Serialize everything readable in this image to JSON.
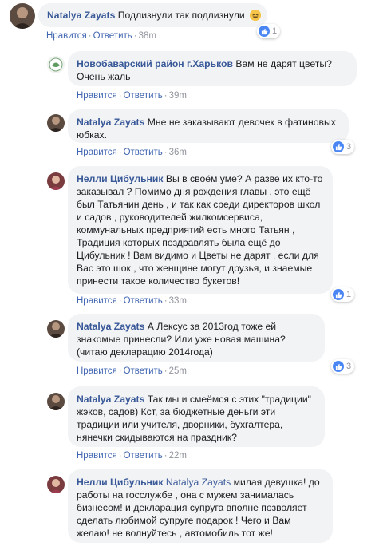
{
  "comments": [
    {
      "author": "Natalya Zayats",
      "text": "Подлизнули так подлизнули",
      "emoji": "laughing-emoji",
      "like_label": "Нравится",
      "reply_label": "Ответить",
      "time": "38m",
      "reactions_count": "1"
    },
    {
      "author": "Новобаварский район г.Харьков",
      "text": "Вам не дарят цветы? Очень жаль",
      "like_label": "Нравится",
      "reply_label": "Ответить",
      "time": "39m"
    },
    {
      "author": "Natalya Zayats",
      "text": "Мне не заказывают девочек в фатиновых юбках.",
      "like_label": "Нравится",
      "reply_label": "Ответить",
      "time": "36m",
      "reactions_count": "3"
    },
    {
      "author": "Нелли Цибульник",
      "text": "Вы в своём уме? А разве их кто-то заказывал ? Помимо дня рождения главы , это ещё был Татьянин день , и так как среди директоров школ и садов , руководителей жилкомсервиса, коммунальных предприятий есть много Татьян , Традиция которых поздравлять была ещё до Цибульник ! Вам видимо и Цветы не дарят , если для Вас это шок , что женщине могут друзья, и знаемые принести такое количество букетов!",
      "like_label": "Нравится",
      "reply_label": "Ответить",
      "time": "33m",
      "reactions_count": "1"
    },
    {
      "author": "Natalya Zayats",
      "text": "А Лексус за 2013год тоже ей знакомые принесли? Или уже новая машина? (читаю декларацию 2014года)",
      "like_label": "Нравится",
      "reply_label": "Ответить",
      "time": "25m",
      "reactions_count": "3"
    },
    {
      "author": "Natalya Zayats",
      "text": "Так мы и смеёмся с этих \"традиции\" жэков, садов) Кст, за бюджетные деньги эти традиции или учителя, дворники, бухгалтера, нянечки скидываются на праздник?",
      "like_label": "Нравится",
      "reply_label": "Ответить",
      "time": "22m"
    },
    {
      "author": "Нелли Цибульник",
      "mention": "Natalya Zayats",
      "text": "милая девушка! до работы на госслужбе , она с мужем занималась бизнесом! и декларация супруга вполне позволяет сделать любимой супруге подарок ! Чего и Вам желаю! не волнуйтесь , автомобиль тот же!"
    }
  ],
  "colors": {
    "author": "#385898",
    "bubble_bg": "#f2f3f5",
    "link": "#4267b2",
    "meta": "#90949c",
    "like_blue": "#4a86f3"
  }
}
